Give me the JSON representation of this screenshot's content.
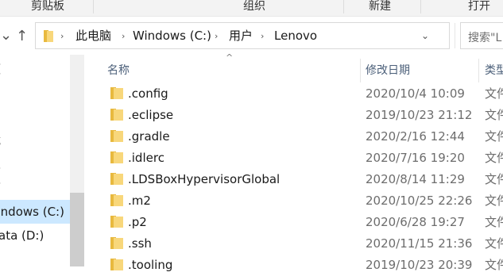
{
  "ribbon": {
    "groups": [
      "剪贴板",
      "组织",
      "新建",
      "打开"
    ]
  },
  "address": {
    "crumbs": [
      "此电脑",
      "Windows (C:)",
      "用户",
      "Lenovo"
    ]
  },
  "search": {
    "placeholder": "搜索\"L"
  },
  "nav_pane": {
    "items": [
      {
        "label": "频"
      },
      {
        "label": "片"
      },
      {
        "label": "档"
      },
      {
        "label": "载"
      },
      {
        "label": "乐"
      },
      {
        "label": "面"
      },
      {
        "label": "Windows (C:)"
      },
      {
        "label": "ata (D:)"
      }
    ]
  },
  "columns": {
    "name": "名称",
    "modified": "修改日期",
    "type": "类型"
  },
  "files": [
    {
      "name": ".config",
      "modified": "2020/10/4 10:09",
      "type": "文件"
    },
    {
      "name": ".eclipse",
      "modified": "2019/10/23 21:12",
      "type": "文件"
    },
    {
      "name": ".gradle",
      "modified": "2020/2/16 12:44",
      "type": "文件"
    },
    {
      "name": ".idlerc",
      "modified": "2020/7/16 19:20",
      "type": "文件"
    },
    {
      "name": ".LDSBoxHypervisorGlobal",
      "modified": "2020/8/14 11:29",
      "type": "文件"
    },
    {
      "name": ".m2",
      "modified": "2020/10/25 22:26",
      "type": "文件"
    },
    {
      "name": ".p2",
      "modified": "2020/6/28 19:27",
      "type": "文件"
    },
    {
      "name": ".ssh",
      "modified": "2020/11/15 21:36",
      "type": "文件"
    },
    {
      "name": ".tooling",
      "modified": "2019/10/23 20:39",
      "type": "文件"
    }
  ]
}
